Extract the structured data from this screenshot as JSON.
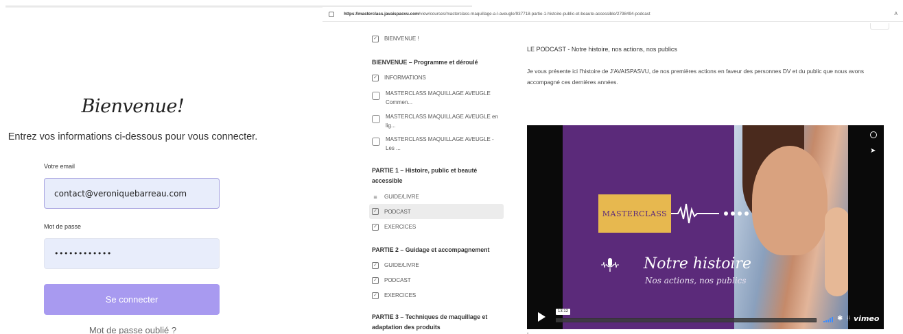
{
  "login": {
    "title": "Bienvenue!",
    "subtitle": "Entrez vos informations ci-dessous pour vous connecter.",
    "email_label": "Votre email",
    "email_value": "contact@veroniquebarreau.com",
    "password_label": "Mot de passe",
    "password_value": "••••••••••••",
    "submit_label": "Se connecter",
    "forgot_label": "Mot de passe oublié ?",
    "accent_color": "#a89af0"
  },
  "browser": {
    "url_host": "https://masterclass.javaispasvu.com",
    "url_path": "/view/courses/masterclass-maquillage-a-l-aveugle/937718-partie-1-histoire-public-et-beaute-accessible/2798494-podcast",
    "font_icon": "A"
  },
  "sidebar": {
    "items": [
      {
        "label": "BIENVENUE !",
        "icon": "check-square-icon"
      },
      {
        "label": "INFORMATIONS",
        "icon": "check-square-icon"
      },
      {
        "label": "MASTERCLASS MAQUILLAGE AVEUGLE Commen...",
        "icon": "document-icon"
      },
      {
        "label": "MASTERCLASS MAQUILLAGE AVEUGLE en lig...",
        "icon": "document-icon"
      },
      {
        "label": "MASTERCLASS MAQUILLAGE AVEUGLE - Les ...",
        "icon": "document-icon"
      },
      {
        "label": "GUIDE/LIVRE",
        "icon": "list-icon"
      },
      {
        "label": "PODCAST",
        "icon": "check-square-icon",
        "active": true
      },
      {
        "label": "EXERCICES",
        "icon": "check-square-icon"
      },
      {
        "label": "GUIDE/LIVRE",
        "icon": "check-square-icon"
      },
      {
        "label": "PODCAST",
        "icon": "check-square-icon"
      },
      {
        "label": "EXERCICES",
        "icon": "check-square-icon"
      }
    ],
    "sections": [
      "BIENVENUE – Programme et déroulé",
      "PARTIE 1 – Histoire, public et beauté accessible",
      "PARTIE 2 – Guidage et accompagnement",
      "PARTIE 3 – Techniques de maquillage et adaptation des produits"
    ]
  },
  "lesson": {
    "title": "LE PODCAST  - Notre histoire, nos actions, nos publics",
    "description": "Je vous présente ici l'histoire de J'AVAISPASVU, de nos premières actions en faveur des personnes DV et du public que nous avons accompagné ces dernières années."
  },
  "video": {
    "masterclass_text": "MASTERCLASS",
    "headline": "Notre histoire",
    "subline": "Nos actions, nos publics",
    "time": "13:12",
    "player_brand": "vimeo",
    "purple": "#5b2a7a",
    "gold": "#e7b84f"
  },
  "footnote": "\""
}
